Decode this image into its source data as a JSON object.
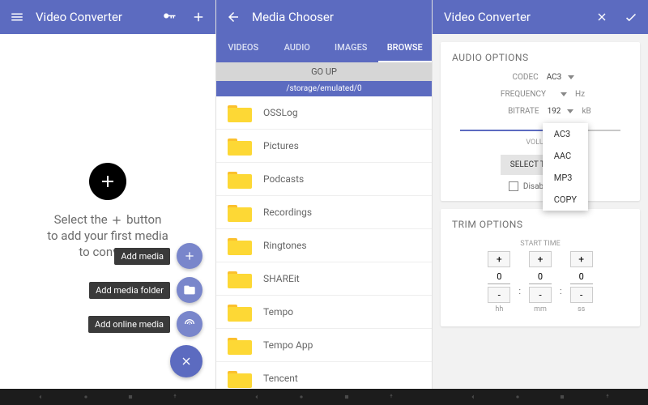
{
  "panel1": {
    "title": "Video Converter",
    "hint_line1": "Select the",
    "hint_line2": "button",
    "hint_line3": "to add your first media",
    "hint_line4": "to convert.",
    "fabs": {
      "add_media": "Add media",
      "add_folder": "Add media folder",
      "add_online": "Add online media"
    }
  },
  "panel2": {
    "title": "Media Chooser",
    "tabs": [
      "VIDEOS",
      "AUDIO",
      "IMAGES",
      "BROWSE"
    ],
    "go_up": "GO UP",
    "path": "/storage/emulated/0",
    "folders": [
      "OSSLog",
      "Pictures",
      "Podcasts",
      "Recordings",
      "Ringtones",
      "SHAREit",
      "Tempo",
      "Tempo App",
      "Tencent"
    ]
  },
  "panel3": {
    "title": "Video Converter",
    "audio": {
      "title": "AUDIO OPTIONS",
      "codec_label": "CODEC",
      "codec_value": "AC3",
      "codec_options": [
        "AC3",
        "AAC",
        "MP3",
        "COPY"
      ],
      "freq_label": "FREQUENCY",
      "freq_value": "",
      "freq_unit": "Hz",
      "bitrate_label": "BITRATE",
      "bitrate_value": "192",
      "bitrate_unit": "kB",
      "volume_label": "VOLUME",
      "select_tracks": "SELECT TRACKS",
      "disable_audio": "Disable audio"
    },
    "trim": {
      "title": "TRIM OPTIONS",
      "start_label": "START TIME",
      "hh": "0",
      "mm": "0",
      "ss": "0",
      "hh_label": "hh",
      "mm_label": "mm",
      "ss_label": "ss"
    }
  }
}
